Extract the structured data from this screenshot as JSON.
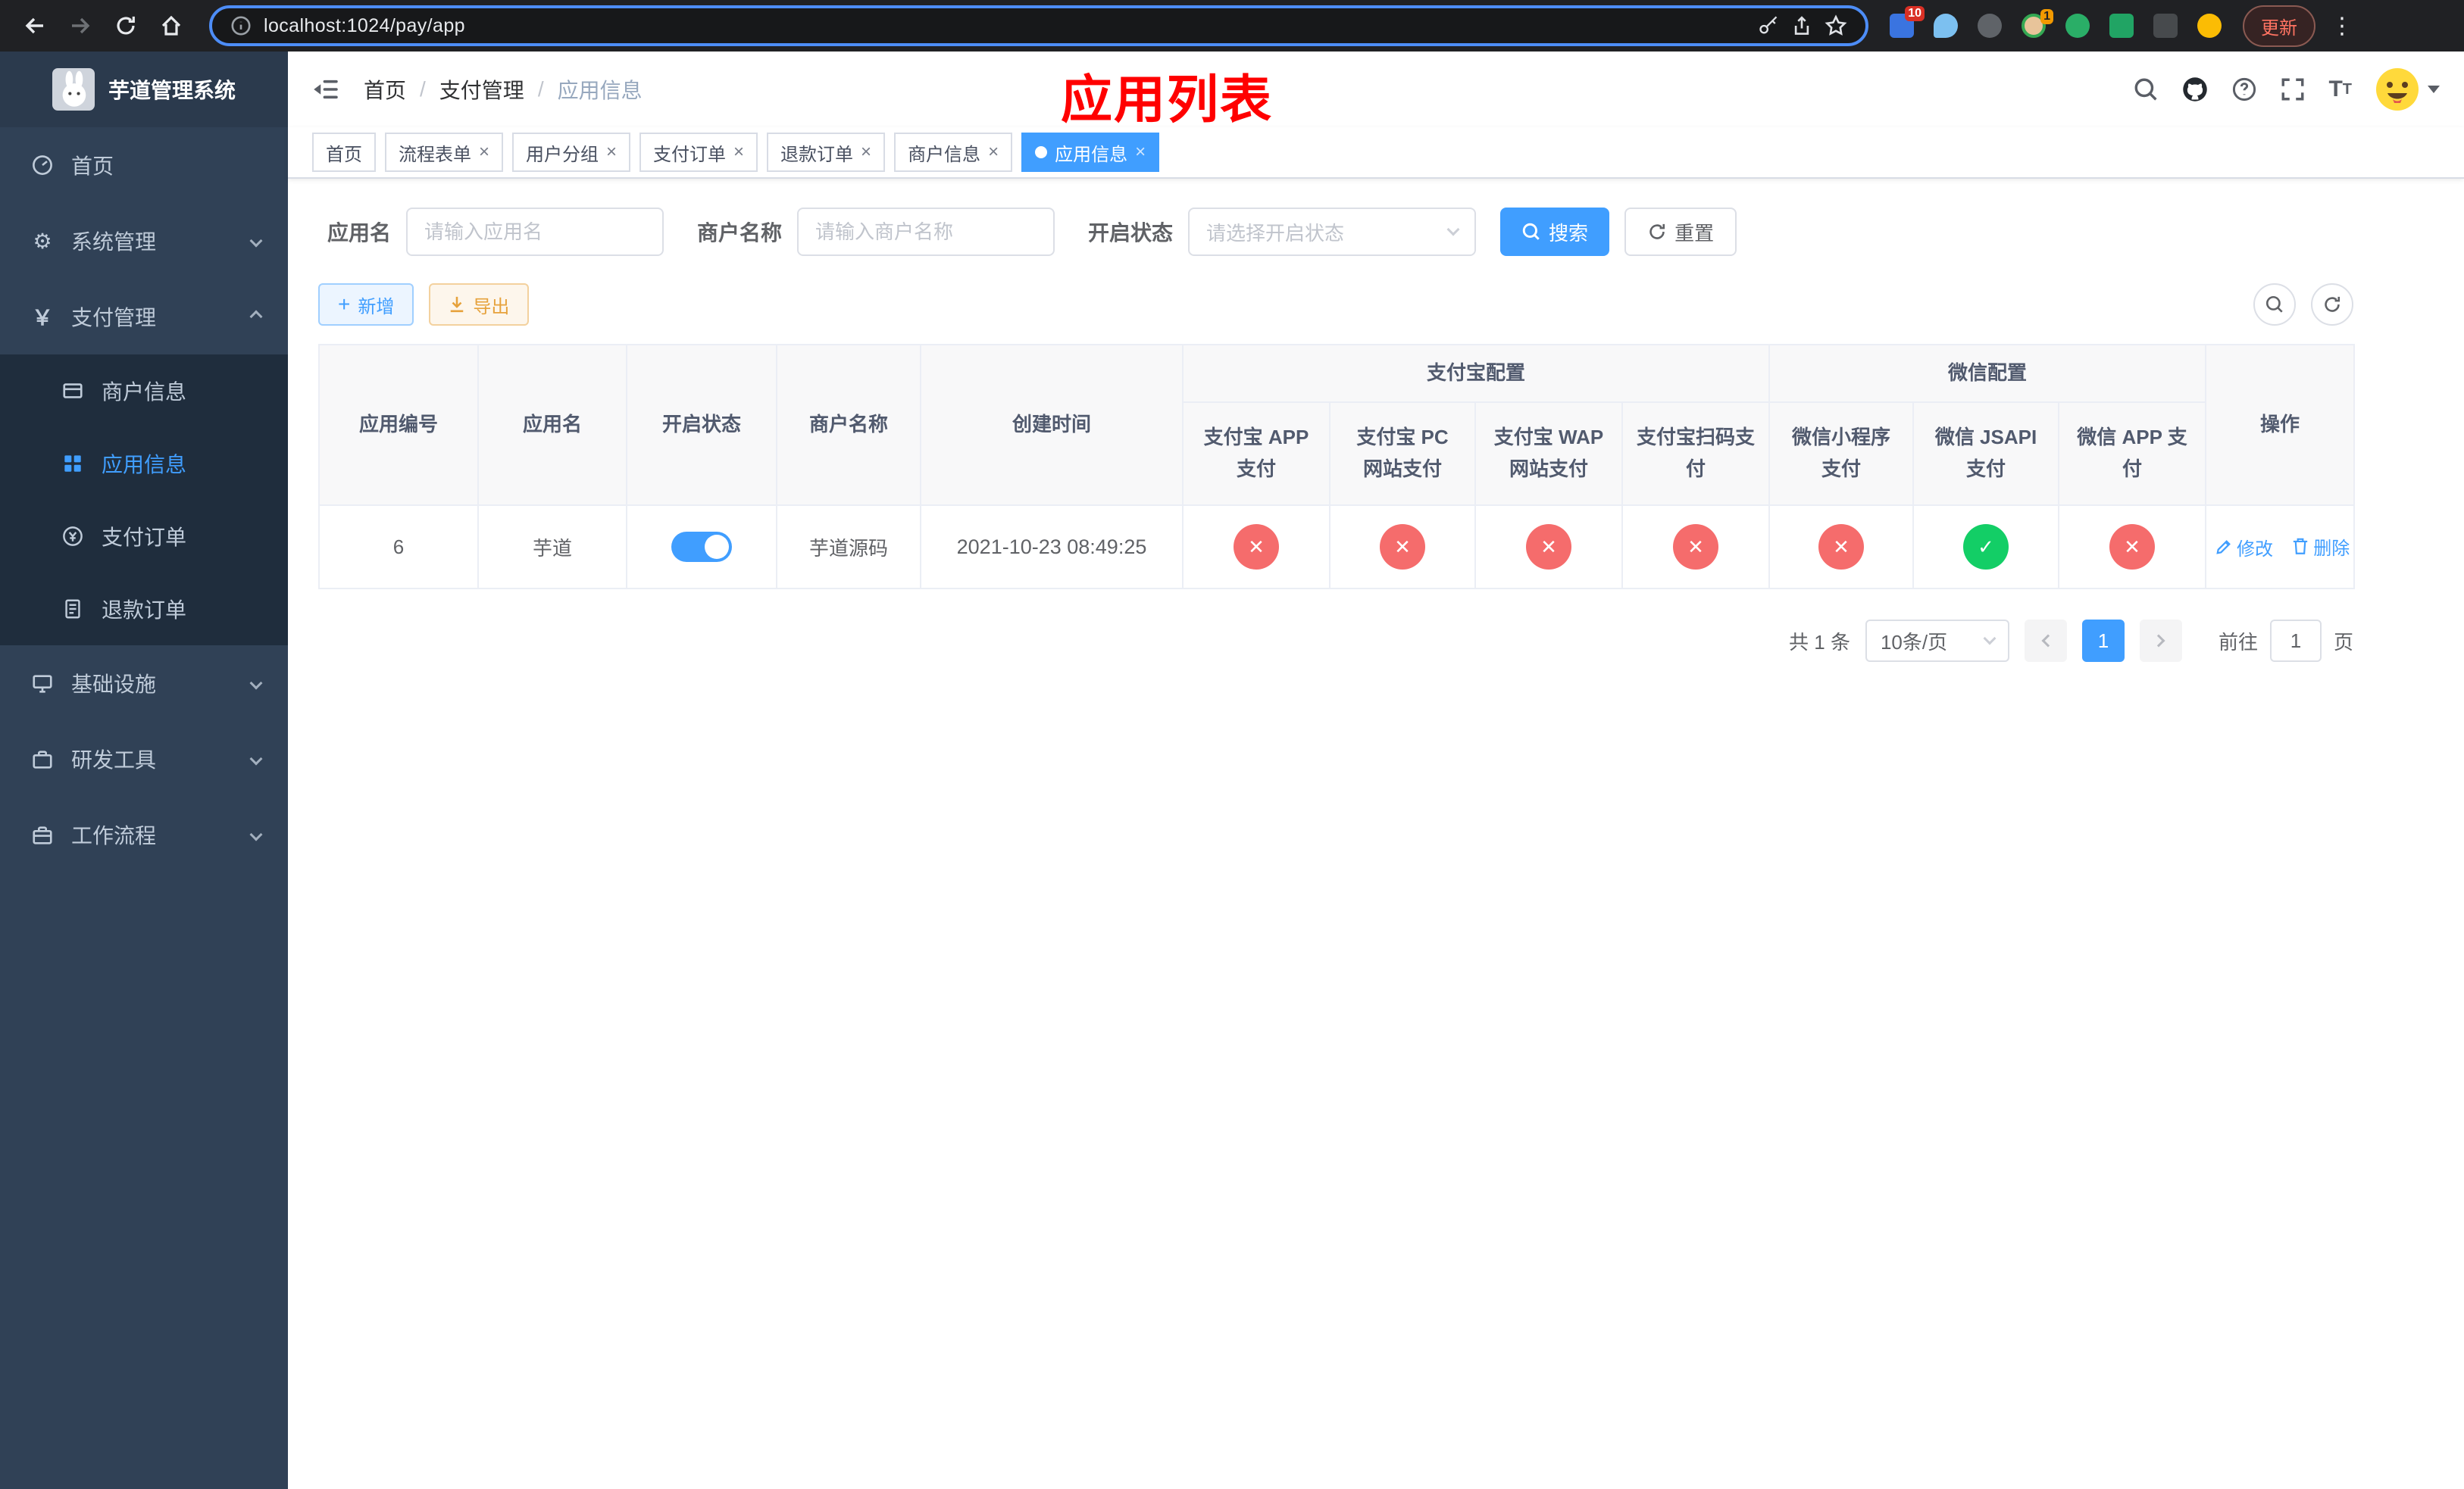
{
  "browser": {
    "url": "localhost:1024/pay/app",
    "update_button": "更新",
    "ext_badge_1": "10",
    "ext_badge_2": "1"
  },
  "sidebar": {
    "logo_title": "芋道管理系统",
    "items": [
      {
        "label": "首页"
      },
      {
        "label": "系统管理"
      },
      {
        "label": "支付管理"
      },
      {
        "label": "基础设施"
      },
      {
        "label": "研发工具"
      },
      {
        "label": "工作流程"
      }
    ],
    "submenu": [
      {
        "label": "商户信息"
      },
      {
        "label": "应用信息"
      },
      {
        "label": "支付订单"
      },
      {
        "label": "退款订单"
      }
    ]
  },
  "header": {
    "breadcrumb": [
      "首页",
      "支付管理",
      "应用信息"
    ],
    "overlay_title": "应用列表"
  },
  "tabs": [
    {
      "label": "首页"
    },
    {
      "label": "流程表单"
    },
    {
      "label": "用户分组"
    },
    {
      "label": "支付订单"
    },
    {
      "label": "退款订单"
    },
    {
      "label": "商户信息"
    },
    {
      "label": "应用信息"
    }
  ],
  "filters": {
    "app_name_label": "应用名",
    "app_name_placeholder": "请输入应用名",
    "merchant_label": "商户名称",
    "merchant_placeholder": "请输入商户名称",
    "status_label": "开启状态",
    "status_placeholder": "请选择开启状态",
    "search_button": "搜索",
    "reset_button": "重置"
  },
  "toolbar": {
    "add_button": "新增",
    "export_button": "导出"
  },
  "table": {
    "headers": {
      "app_id": "应用编号",
      "app_name": "应用名",
      "status": "开启状态",
      "merchant": "商户名称",
      "created": "创建时间",
      "alipay_group": "支付宝配置",
      "wechat_group": "微信配置",
      "alipay_app": "支付宝 APP 支付",
      "alipay_pc": "支付宝 PC 网站支付",
      "alipay_wap": "支付宝 WAP 网站支付",
      "alipay_qr": "支付宝扫码支付",
      "wx_mini": "微信小程序支付",
      "wx_jsapi": "微信 JSAPI 支付",
      "wx_app": "微信 APP 支付",
      "actions": "操作"
    },
    "row": {
      "app_id": "6",
      "app_name": "芋道",
      "status_on": true,
      "merchant": "芋道源码",
      "created": "2021-10-23 08:49:25",
      "channels": [
        "fail",
        "fail",
        "fail",
        "fail",
        "fail",
        "success",
        "fail"
      ],
      "edit_label": "修改",
      "delete_label": "删除"
    }
  },
  "pagination": {
    "total": "共 1 条",
    "page_size": "10条/页",
    "page": "1",
    "goto_label": "前往",
    "goto_value": "1",
    "unit": "页"
  },
  "colors": {
    "primary": "#409eff",
    "danger": "#f56c6c",
    "success": "#13ce66",
    "annotation": "#ff0000"
  }
}
